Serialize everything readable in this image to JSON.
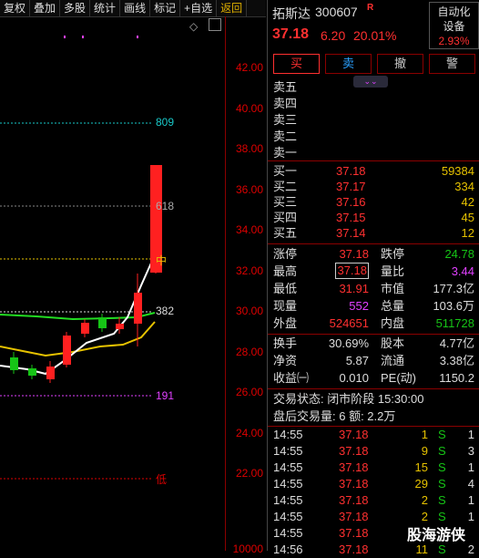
{
  "toolbar": {
    "items": [
      "复权",
      "叠加",
      "多股",
      "统计",
      "画线",
      "标记",
      "+自选",
      "返回"
    ]
  },
  "chart": {
    "price_ticks": [
      "42.00",
      "40.00",
      "38.00",
      "36.00",
      "34.00",
      "32.00",
      "30.00",
      "28.00",
      "26.00",
      "24.00",
      "22.00"
    ],
    "bottom_tick": "10000",
    "level_labels": {
      "l809": "809",
      "l618": "618",
      "mid": "中",
      "l382": "382",
      "l191": "191",
      "low": "低"
    },
    "collapse_icon": "diamond-icon",
    "colors": {
      "up": "#ff2020",
      "down": "#16c416",
      "ma_white": "#ffffff",
      "ma_yellow": "#e6c200",
      "ma_green": "#22dd22"
    }
  },
  "stock": {
    "name": "拓斯达",
    "code": "300607",
    "flag": "R",
    "price": "37.18",
    "change": "6.20",
    "change_pct": "20.01%",
    "sector": "自动化设备",
    "sector_pct": "2.93%"
  },
  "trade_buttons": [
    "买",
    "卖",
    "撤",
    "警"
  ],
  "asks": [
    {
      "label": "卖五",
      "price": "",
      "vol": ""
    },
    {
      "label": "卖四",
      "price": "",
      "vol": ""
    },
    {
      "label": "卖三",
      "price": "",
      "vol": ""
    },
    {
      "label": "卖二",
      "price": "",
      "vol": ""
    },
    {
      "label": "卖一",
      "price": "",
      "vol": ""
    }
  ],
  "bids": [
    {
      "label": "买一",
      "price": "37.18",
      "vol": "59384"
    },
    {
      "label": "买二",
      "price": "37.17",
      "vol": "334"
    },
    {
      "label": "买三",
      "price": "37.16",
      "vol": "42"
    },
    {
      "label": "买四",
      "price": "37.15",
      "vol": "45"
    },
    {
      "label": "买五",
      "price": "37.14",
      "vol": "12"
    }
  ],
  "stats": [
    {
      "l1": "涨停",
      "v1": "37.18",
      "l2": "跌停",
      "v2": "24.78"
    },
    {
      "l1": "最高",
      "v1": "37.18",
      "l2": "量比",
      "v2": "3.44"
    },
    {
      "l1": "最低",
      "v1": "31.91",
      "l2": "市值",
      "v2": "177.3亿"
    },
    {
      "l1": "现量",
      "v1": "552",
      "l2": "总量",
      "v2": "103.6万"
    },
    {
      "l1": "外盘",
      "v1": "524651",
      "l2": "内盘",
      "v2": "511728"
    }
  ],
  "stats2": [
    {
      "l1": "换手",
      "v1": "30.69%",
      "l2": "股本",
      "v2": "4.77亿"
    },
    {
      "l1": "净资",
      "v1": "5.87",
      "l2": "流通",
      "v2": "3.38亿"
    },
    {
      "l1": "收益㈠",
      "v1": "0.010",
      "l2": "PE(动)",
      "v2": "1150.2"
    }
  ],
  "status": {
    "line1": "交易状态: 闭市阶段 15:30:00",
    "line2_label": "盘后交易量: 6  额: 2.2万"
  },
  "ticks": [
    {
      "time": "14:55",
      "price": "37.18",
      "vol": "1",
      "side": "S",
      "n": "1"
    },
    {
      "time": "14:55",
      "price": "37.18",
      "vol": "9",
      "side": "S",
      "n": "3"
    },
    {
      "time": "14:55",
      "price": "37.18",
      "vol": "15",
      "side": "S",
      "n": "1"
    },
    {
      "time": "14:55",
      "price": "37.18",
      "vol": "29",
      "side": "S",
      "n": "4"
    },
    {
      "time": "14:55",
      "price": "37.18",
      "vol": "2",
      "side": "S",
      "n": "1"
    },
    {
      "time": "14:55",
      "price": "37.18",
      "vol": "2",
      "side": "S",
      "n": "1"
    },
    {
      "time": "14:55",
      "price": "37.18",
      "vol": "",
      "side": "",
      "n": ""
    },
    {
      "time": "14:56",
      "price": "37.18",
      "vol": "11",
      "side": "S",
      "n": "2"
    }
  ],
  "watermark": "股海游侠"
}
